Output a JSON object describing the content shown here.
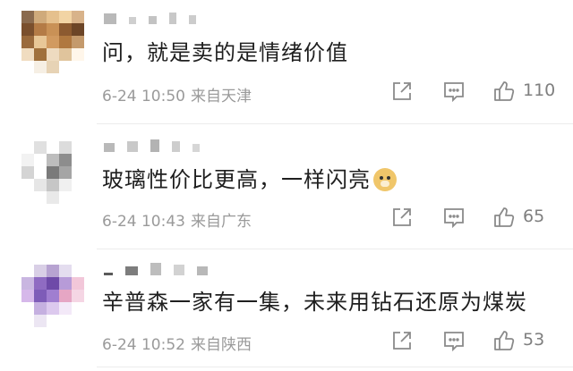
{
  "comments": [
    {
      "text": "问，就是卖的是情绪价值",
      "time": "6-24 10:50",
      "location": "来自天津",
      "likes": "110",
      "emoji": ""
    },
    {
      "text": "玻璃性价比更高，一样闪亮",
      "time": "6-24 10:43",
      "location": "来自广东",
      "likes": "65",
      "emoji": "doge-emoji"
    },
    {
      "text": "辛普森一家有一集，未来用钻石还原为煤炭",
      "time": "6-24 10:52",
      "location": "来自陕西",
      "likes": "53",
      "emoji": ""
    }
  ],
  "icons": {
    "share": "share-icon",
    "reply": "comment-icon",
    "like": "thumbs-up-icon"
  },
  "colors": {
    "text": "#1f1f1f",
    "meta": "#9a9a9a",
    "icon": "#8a8a8a"
  }
}
